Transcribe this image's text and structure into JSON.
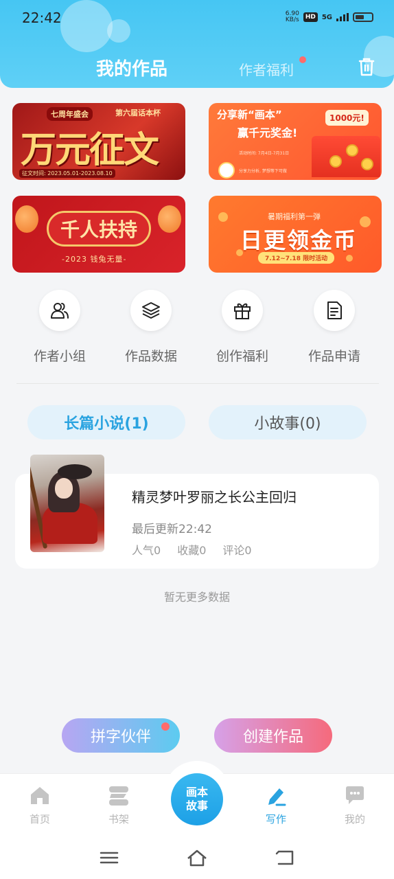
{
  "status_bar": {
    "time": "22:42",
    "net_speed_value": "6.90",
    "net_speed_unit": "KB/s",
    "hd_badge": "HD",
    "signal": "5G"
  },
  "header": {
    "tab_active": "我的作品",
    "tab_inactive": "作者福利",
    "trash_icon": "trash-icon"
  },
  "banners": {
    "b1": {
      "tag": "七周年盛会",
      "tag2": "第六届话本杯",
      "big": "万元征文",
      "small": "征文时间: 2023.05.01-2023.08.10"
    },
    "b2": {
      "t1": "分享新“画本”",
      "t2": "赢千元奖金!",
      "prize": "1000元!",
      "small": "活动时间: 7月4日-7月31日",
      "small2": "分享力分析, 梦想等下可做"
    },
    "b3": {
      "t1": "千人扶持",
      "t2": "-2023 钱兔无量-"
    },
    "b4": {
      "t1": "暑期福利第一弹",
      "t2": "日更领金币",
      "pill": "7.12~7.18 限时活动"
    }
  },
  "quick_actions": [
    {
      "label": "作者小组",
      "icon": "users-icon"
    },
    {
      "label": "作品数据",
      "icon": "layers-icon"
    },
    {
      "label": "创作福利",
      "icon": "gift-icon"
    },
    {
      "label": "作品申请",
      "icon": "document-icon"
    }
  ],
  "work_tabs": {
    "active": "长篇小说(1)",
    "inactive": "小故事(0)"
  },
  "work": {
    "title": "精灵梦叶罗丽之长公主回归",
    "updated": "最后更新22:42",
    "popularity": "人气0",
    "favorites": "收藏0",
    "comments": "评论0"
  },
  "no_more": "暂无更多数据",
  "buttons": {
    "partner": "拼字伙伴",
    "create": "创建作品"
  },
  "bottom_nav": {
    "home": "首页",
    "shelf": "书架",
    "center_line1": "画本",
    "center_line2": "故事",
    "write": "写作",
    "mine": "我的"
  },
  "colors": {
    "accent": "#2aa3e0",
    "header": "#46c6f3",
    "badge_dot": "#ff6b6b"
  }
}
